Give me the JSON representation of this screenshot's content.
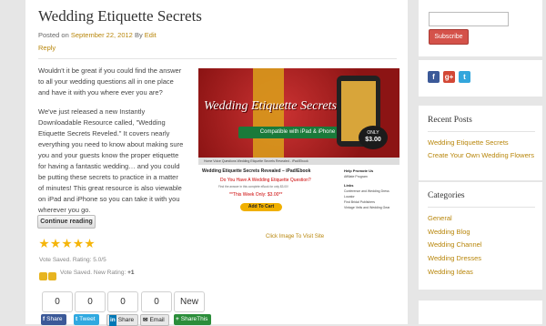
{
  "post": {
    "title": "Wedding Etiquette Secrets",
    "meta_prefix": "Posted on",
    "date": "September 22, 2012",
    "by": "By",
    "author": "Edit",
    "reply": "Reply",
    "paragraph1": "Wouldn't it be great if you could find the answer to all your wedding questions all in one place and have it with you where ever you are?",
    "paragraph2": "We've just released a new Instantly Downloadable Resource called, \"Wedding Etiquette Secrets Reveled.\" It covers nearly everything you need to know about making sure you and your guests know the proper etiquette for having a fantastic wedding… and you could be putting these secrets to practice in a matter of minutes! This great resource is also viewable on iPad and iPhone so you can take it with you wherever you go.",
    "continue_label": "Continue reading"
  },
  "ad": {
    "banner_title": "Wedding Etiquette Secrets",
    "compat": "Compatible with iPad & iPhone",
    "price_line1": "ONLY",
    "price_line2": "$3.00",
    "nav": "Home    Voice Questions    Wedding Etiquette Secrets Revealed - iPad/Ebook",
    "heading": "Wedding Etiquette Secrets Revealed – iPad/Ebook",
    "question": "Do You Have A Wedding Etiquette Question?",
    "small": "Find the answer in this complete eBook for only $3.00!",
    "week": "**This Week Only: $3.00**",
    "cart": "Add To Cart",
    "side_title1": "Help Promote Us",
    "side_text1": "Affiliate Program",
    "side_title2": "Links",
    "side_links": [
      "Conference and Wedding Dress Locator",
      "Find Bridal Publishers",
      "Vintage Veils and Wedding Gear"
    ],
    "caption": "Click Image To Visit Site"
  },
  "rating": {
    "stars": 5,
    "vote_text": "Vote Saved. Rating: 5.0/5",
    "vote2_prefix": "Vote Saved.",
    "vote2_label": "New Rating:",
    "vote2_value": "+1"
  },
  "share_counts": [
    "0",
    "0",
    "0",
    "0",
    "New"
  ],
  "share_buttons": [
    {
      "icon": "f",
      "label": "Share",
      "color": "#3b5998"
    },
    {
      "icon": "t",
      "label": "Tweet",
      "color": "#2fa9e0"
    },
    {
      "icon": "in",
      "label": "Share",
      "color": "#e8e8e8"
    },
    {
      "icon": "✉",
      "label": "Email",
      "color": "#e8e8e8"
    },
    {
      "icon": "+",
      "label": "ShareThis",
      "color": "#2b8d3a"
    }
  ],
  "sidebar": {
    "subscribe_label": "Subscribe",
    "social_icons": [
      {
        "icon": "f",
        "color": "#3b5998"
      },
      {
        "icon": "g+",
        "color": "#d34836"
      },
      {
        "icon": "t",
        "color": "#33a6dc"
      }
    ],
    "recent_title": "Recent Posts",
    "recent_posts": [
      "Wedding Etiquette Secrets",
      "Create Your Own Wedding Flowers"
    ],
    "categories_title": "Categories",
    "categories": [
      "General",
      "Wedding Blog",
      "Wedding Channel",
      "Wedding Dresses",
      "Wedding Ideas"
    ]
  },
  "colors": {
    "link": "#b8860b",
    "subscribe": "#d4524a",
    "star": "#f5b50a"
  }
}
